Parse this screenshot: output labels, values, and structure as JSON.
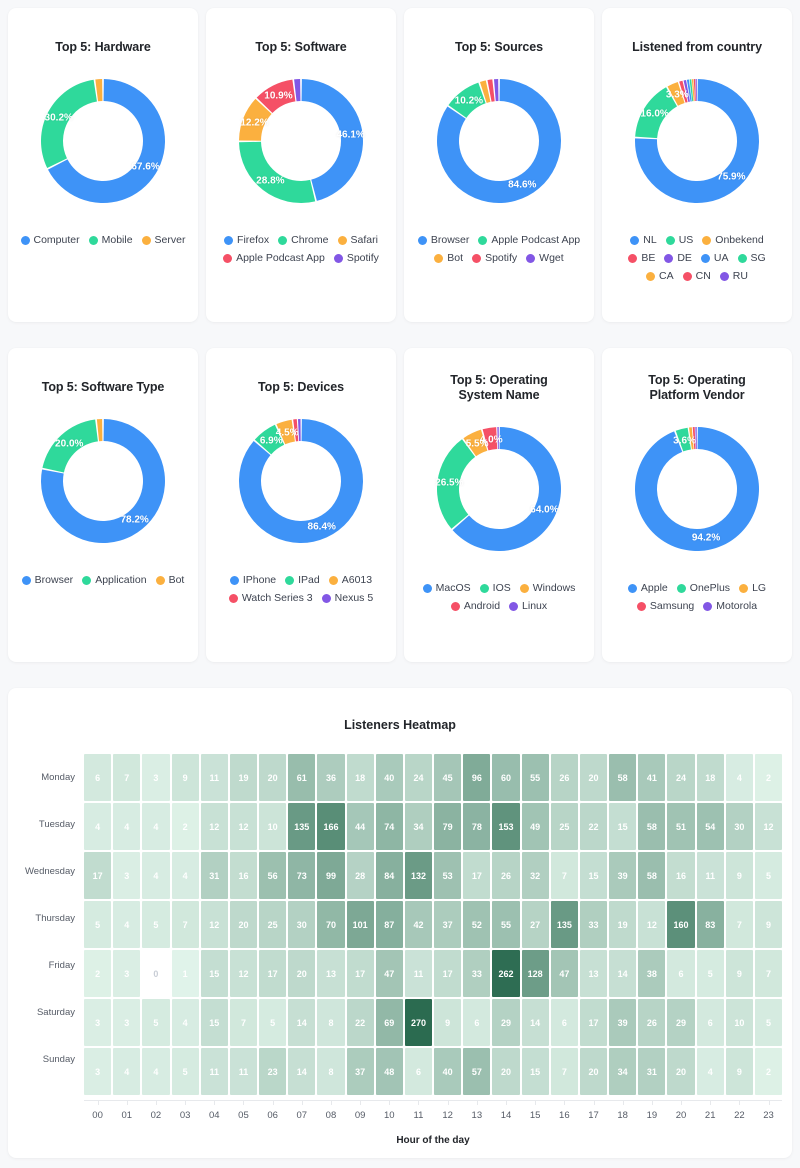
{
  "palette": {
    "blue": "#3e93f7",
    "green": "#2fd99b",
    "amber": "#fbb03f",
    "red": "#f55066",
    "purple": "#8257e5",
    "background": "#f7f8fa",
    "card": "#ffffff",
    "title": "#22252a",
    "legend_text": "#3d4350"
  },
  "donuts": [
    {
      "title": "Top 5: Hardware",
      "chart_data": {
        "type": "pie",
        "title": "Top 5: Hardware",
        "labels": [
          "Computer",
          "Mobile",
          "Server"
        ],
        "values": [
          67.6,
          30.2,
          2.2
        ],
        "value_labels": [
          "67.6%",
          "30.2%",
          ""
        ],
        "colors": [
          "#3e93f7",
          "#2fd99b",
          "#fbb03f"
        ],
        "legend_position": "bottom"
      }
    },
    {
      "title": "Top 5: Software",
      "chart_data": {
        "type": "pie",
        "title": "Top 5: Software",
        "labels": [
          "Firefox",
          "Chrome",
          "Safari",
          "Apple Podcast App",
          "Spotify"
        ],
        "values": [
          46.1,
          28.8,
          12.2,
          10.9,
          2.0
        ],
        "value_labels": [
          "46.1%",
          "28.8%",
          "12.2%",
          "10.9%",
          ""
        ],
        "colors": [
          "#3e93f7",
          "#2fd99b",
          "#fbb03f",
          "#f55066",
          "#8257e5"
        ],
        "legend_position": "bottom"
      }
    },
    {
      "title": "Top 5: Sources",
      "chart_data": {
        "type": "pie",
        "title": "Top 5: Sources",
        "labels": [
          "Browser",
          "Apple Podcast App",
          "Bot",
          "Spotify",
          "Wget"
        ],
        "values": [
          84.6,
          10.2,
          2.0,
          1.7,
          1.5
        ],
        "value_labels": [
          "84.6%",
          "10.2%",
          "",
          "",
          ""
        ],
        "colors": [
          "#3e93f7",
          "#2fd99b",
          "#fbb03f",
          "#f55066",
          "#8257e5"
        ],
        "legend_position": "bottom"
      }
    },
    {
      "title": "Listened from country",
      "chart_data": {
        "type": "pie",
        "title": "Listened from country",
        "labels": [
          "NL",
          "US",
          "Onbekend",
          "BE",
          "DE",
          "UA",
          "SG",
          "CA",
          "CN",
          "RU"
        ],
        "values": [
          75.9,
          16.0,
          3.3,
          1.2,
          0.9,
          0.7,
          0.6,
          0.5,
          0.5,
          0.4
        ],
        "value_labels": [
          "75.9%",
          "16.0%",
          "3.3%",
          "",
          "",
          "",
          "",
          "",
          "",
          ""
        ],
        "colors": [
          "#3e93f7",
          "#2fd99b",
          "#fbb03f",
          "#f55066",
          "#8257e5",
          "#3e93f7",
          "#2fd99b",
          "#fbb03f",
          "#f55066",
          "#8257e5"
        ],
        "legend_position": "bottom"
      }
    },
    {
      "title": "Top 5: Software Type",
      "chart_data": {
        "type": "pie",
        "title": "Top 5: Software Type",
        "labels": [
          "Browser",
          "Application",
          "Bot"
        ],
        "values": [
          78.2,
          20.0,
          1.8
        ],
        "value_labels": [
          "78.2%",
          "20.0%",
          ""
        ],
        "colors": [
          "#3e93f7",
          "#2fd99b",
          "#fbb03f"
        ],
        "legend_position": "bottom"
      }
    },
    {
      "title": "Top 5: Devices",
      "chart_data": {
        "type": "pie",
        "title": "Top 5: Devices",
        "labels": [
          "IPhone",
          "IPad",
          "A6013",
          "Watch Series 3",
          "Nexus 5"
        ],
        "values": [
          86.4,
          6.9,
          4.5,
          1.3,
          0.9
        ],
        "value_labels": [
          "86.4%",
          "6.9%",
          "4.5%",
          "",
          ""
        ],
        "colors": [
          "#3e93f7",
          "#2fd99b",
          "#fbb03f",
          "#f55066",
          "#8257e5"
        ],
        "legend_position": "bottom"
      }
    },
    {
      "title": "Top 5: Operating System Name",
      "title_lines": [
        "Top 5: Operating",
        "System Name"
      ],
      "chart_data": {
        "type": "pie",
        "title": "Top 5: Operating System Name",
        "labels": [
          "MacOS",
          "IOS",
          "Windows",
          "Android",
          "Linux"
        ],
        "values": [
          64.0,
          26.5,
          5.5,
          4.0,
          0.5
        ],
        "value_labels": [
          "64.0%",
          "26.5%",
          "5.5%",
          "4.0%",
          ""
        ],
        "colors": [
          "#3e93f7",
          "#2fd99b",
          "#fbb03f",
          "#f55066",
          "#8257e5"
        ],
        "legend_position": "bottom"
      }
    },
    {
      "title": "Top 5: Operating Platform Vendor",
      "title_lines": [
        "Top 5: Operating",
        "Platform Vendor"
      ],
      "chart_data": {
        "type": "pie",
        "title": "Top 5: Operating Platform Vendor",
        "labels": [
          "Apple",
          "OnePlus",
          "LG",
          "Samsung",
          "Motorola"
        ],
        "values": [
          94.2,
          3.6,
          1.0,
          0.7,
          0.5
        ],
        "value_labels": [
          "94.2%",
          "3.6%",
          "",
          "",
          ""
        ],
        "colors": [
          "#3e93f7",
          "#2fd99b",
          "#fbb03f",
          "#f55066",
          "#8257e5"
        ],
        "legend_position": "bottom"
      }
    }
  ],
  "heatmap": {
    "title": "Listeners Heatmap",
    "xlabel": "Hour of the day",
    "chart_data": {
      "type": "heatmap",
      "title": "Listeners Heatmap",
      "xlabel": "Hour of the day",
      "ylabel": "",
      "x": [
        "00",
        "01",
        "02",
        "03",
        "04",
        "05",
        "06",
        "07",
        "08",
        "09",
        "10",
        "11",
        "12",
        "13",
        "14",
        "15",
        "16",
        "17",
        "18",
        "19",
        "20",
        "21",
        "22",
        "23"
      ],
      "y": [
        "Monday",
        "Tuesday",
        "Wednesday",
        "Thursday",
        "Friday",
        "Saturday",
        "Sunday"
      ],
      "colorscale": [
        "#e8f9f0",
        "#2b6b50"
      ],
      "vmin": 0,
      "vmax": 270,
      "values": [
        [
          6,
          7,
          3,
          9,
          11,
          19,
          20,
          61,
          36,
          18,
          40,
          24,
          45,
          96,
          60,
          55,
          26,
          20,
          58,
          41,
          24,
          18,
          4,
          2
        ],
        [
          4,
          4,
          4,
          2,
          12,
          12,
          10,
          135,
          166,
          44,
          74,
          34,
          79,
          78,
          153,
          49,
          25,
          22,
          15,
          58,
          51,
          54,
          30,
          12
        ],
        [
          17,
          3,
          4,
          4,
          31,
          16,
          56,
          73,
          99,
          28,
          84,
          132,
          53,
          17,
          26,
          32,
          7,
          15,
          39,
          58,
          16,
          11,
          9,
          5
        ],
        [
          5,
          4,
          5,
          7,
          12,
          20,
          25,
          30,
          70,
          101,
          87,
          42,
          37,
          52,
          55,
          27,
          135,
          33,
          19,
          12,
          160,
          83,
          7,
          9
        ],
        [
          2,
          3,
          0,
          1,
          15,
          12,
          17,
          20,
          13,
          17,
          47,
          11,
          17,
          33,
          262,
          128,
          47,
          13,
          14,
          38,
          6,
          5,
          9,
          7
        ],
        [
          3,
          3,
          5,
          4,
          15,
          7,
          5,
          14,
          8,
          22,
          69,
          270,
          9,
          6,
          29,
          14,
          6,
          17,
          39,
          26,
          29,
          6,
          10,
          5
        ],
        [
          3,
          4,
          4,
          5,
          11,
          11,
          23,
          14,
          8,
          37,
          48,
          6,
          40,
          57,
          20,
          15,
          7,
          20,
          34,
          31,
          20,
          4,
          9,
          2
        ]
      ]
    }
  }
}
